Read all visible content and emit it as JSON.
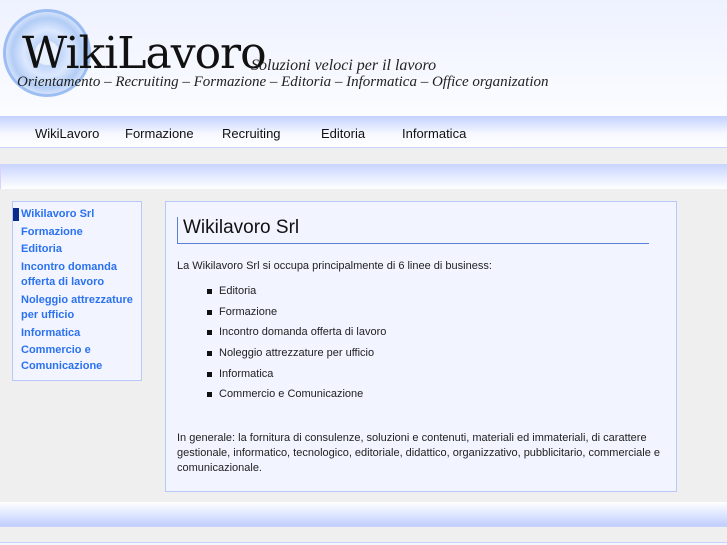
{
  "header": {
    "logo_title": "WikiLavoro",
    "slogan": "Soluzioni veloci per il lavoro",
    "subtitle": "Orientamento – Recruiting – Formazione – Editoria – Informatica – Office organization"
  },
  "nav": {
    "items": [
      {
        "label": "WikiLavoro"
      },
      {
        "label": "Formazione"
      },
      {
        "label": "Recruiting"
      },
      {
        "label": "Editoria"
      },
      {
        "label": "Informatica"
      }
    ]
  },
  "sidebar": {
    "items": [
      {
        "label": "Wikilavoro Srl"
      },
      {
        "label": "Formazione"
      },
      {
        "label": "Editoria"
      },
      {
        "label": "Incontro domanda offerta di lavoro"
      },
      {
        "label": "Noleggio attrezzature per ufficio"
      },
      {
        "label": "Informatica"
      },
      {
        "label": "Commercio e Comunicazione"
      }
    ]
  },
  "content": {
    "title": "Wikilavoro Srl",
    "intro": "La Wikilavoro Srl si occupa principalmente di 6 linee di business:",
    "list": [
      "Editoria",
      "Formazione",
      "Incontro domanda offerta di lavoro",
      "Noleggio attrezzature per ufficio",
      "Informatica",
      "Commercio e Comunicazione"
    ],
    "general": "In generale: la fornitura di consulenze, soluzioni e contenuti, materiali ed immateriali, di carattere gestionale, informatico, tecnologico, editoriale, didattico, organizzativo, pubblicitario, commerciale e comunicazionale."
  },
  "colors": {
    "link": "#2a72f0",
    "accent": "#0a2a8c",
    "border": "#b8c8f8"
  }
}
